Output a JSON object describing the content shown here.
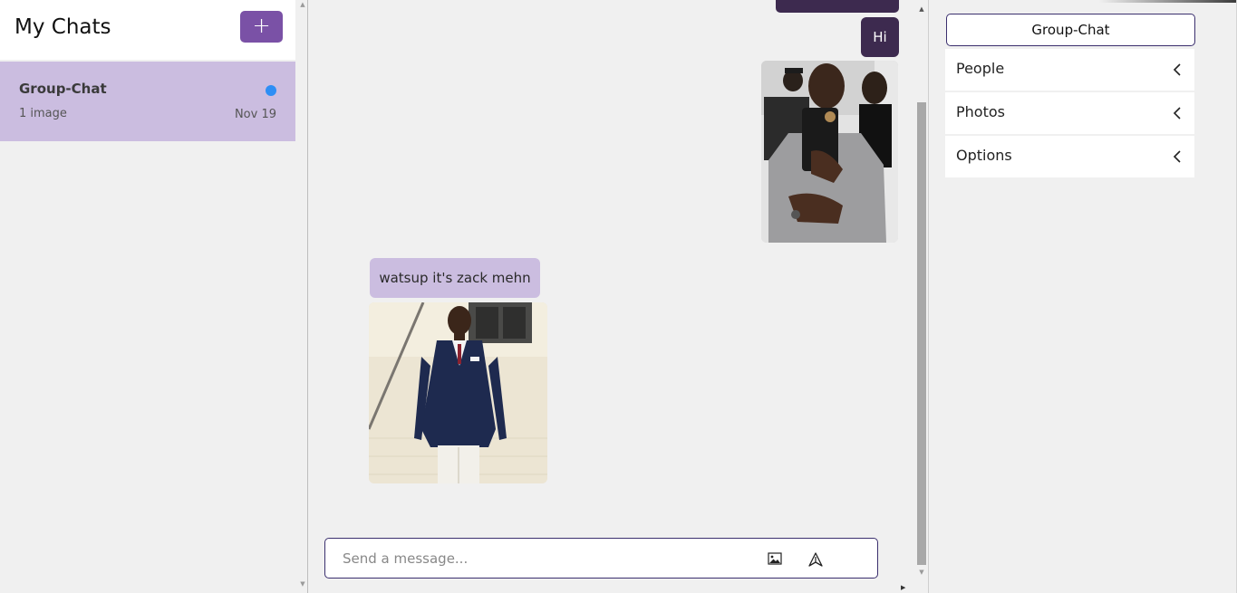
{
  "sidebar": {
    "title": "My Chats",
    "new_chat_label": "+",
    "chats": [
      {
        "name": "Group-Chat",
        "preview": "1 image",
        "date": "Nov 19",
        "unread": true
      }
    ]
  },
  "messages": {
    "outgoing_hi": "Hi",
    "incoming_text": "watsup it's zack mehn"
  },
  "composer": {
    "placeholder": "Send a message..."
  },
  "details_panel": {
    "group_name": "Group-Chat",
    "sections": [
      {
        "label": "People"
      },
      {
        "label": "Photos"
      },
      {
        "label": "Options"
      }
    ]
  },
  "colors": {
    "accent": "#7a51a6",
    "selected_chat": "#cbbde0",
    "outgoing_bubble": "#3d2a4f",
    "unread_dot": "#2e8ef5",
    "border_accent": "#3b2f6e"
  },
  "icons": {
    "attach": "image-icon",
    "send": "send-icon",
    "accordion": "chevron-left-icon"
  }
}
